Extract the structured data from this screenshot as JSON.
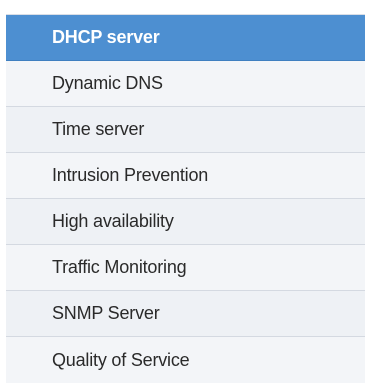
{
  "menu": {
    "items": [
      {
        "label": "DHCP server",
        "active": true
      },
      {
        "label": "Dynamic DNS",
        "active": false
      },
      {
        "label": "Time server",
        "active": false
      },
      {
        "label": "Intrusion Prevention",
        "active": false
      },
      {
        "label": "High availability",
        "active": false
      },
      {
        "label": "Traffic Monitoring",
        "active": false
      },
      {
        "label": "SNMP Server",
        "active": false
      },
      {
        "label": "Quality of Service",
        "active": false
      }
    ]
  },
  "colors": {
    "active_background": "#4d8fd1",
    "active_text": "#ffffff",
    "item_background": "#f3f5f8",
    "item_text": "#2a2a2a",
    "divider": "#d4d9e1"
  }
}
